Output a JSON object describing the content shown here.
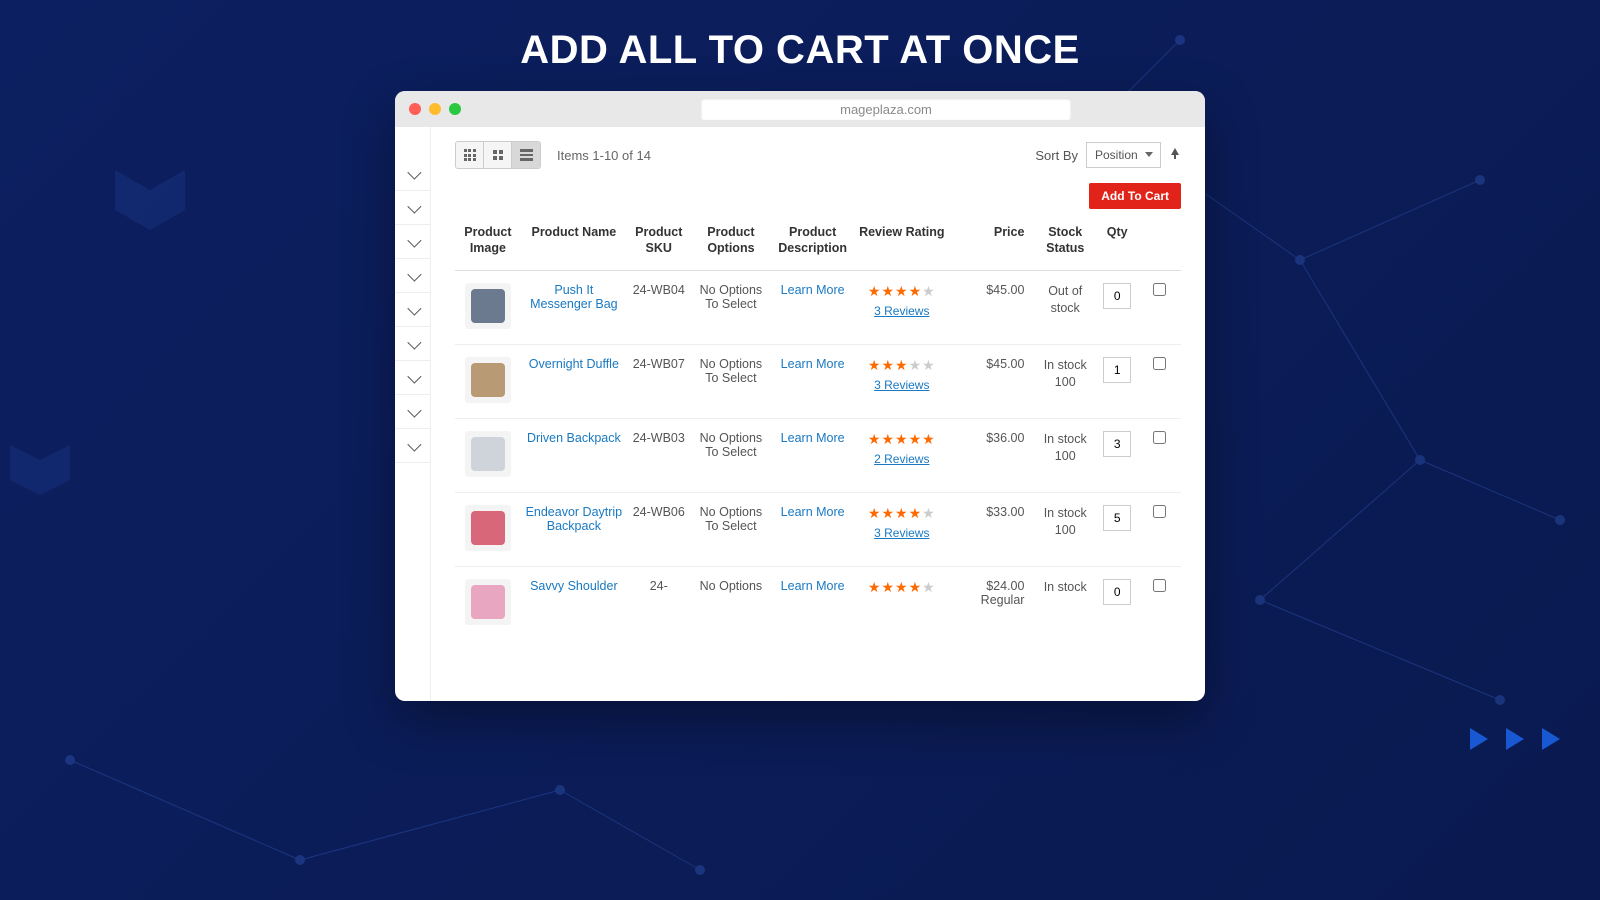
{
  "page": {
    "heading": "ADD ALL TO CART AT ONCE",
    "url": "mageplaza.com"
  },
  "toolbar": {
    "item_count": "Items 1-10 of 14",
    "sort_label": "Sort By",
    "sort_value": "Position",
    "add_to_cart_label": "Add To Cart"
  },
  "sidebar": {
    "filter_count": 9
  },
  "columns": {
    "image": "Product Image",
    "name": "Product Name",
    "sku": "Product SKU",
    "options": "Product Options",
    "description": "Product Description",
    "rating": "Review Rating",
    "price": "Price",
    "stock": "Stock Status",
    "qty": "Qty"
  },
  "common": {
    "learn_more": "Learn More",
    "no_options": "No Options To Select"
  },
  "rows": [
    {
      "name": "Push It Messenger Bag",
      "sku": "24-WB04",
      "rating_on": 3,
      "rating_half": true,
      "reviews": "3 Reviews",
      "price": "$45.00",
      "stock": "Out of stock",
      "qty": "0",
      "img_color": "#6b7a8f"
    },
    {
      "name": "Overnight Duffle",
      "sku": "24-WB07",
      "rating_on": 3,
      "rating_half": false,
      "reviews": "3 Reviews",
      "price": "$45.00",
      "stock": "In stock 100",
      "qty": "1",
      "img_color": "#b89a74"
    },
    {
      "name": "Driven Backpack",
      "sku": "24-WB03",
      "rating_on": 4,
      "rating_half": true,
      "reviews": "2 Reviews",
      "price": "$36.00",
      "stock": "In stock 100",
      "qty": "3",
      "img_color": "#cfd4da"
    },
    {
      "name": "Endeavor Daytrip Backpack",
      "sku": "24-WB06",
      "rating_on": 4,
      "rating_half": false,
      "reviews": "3 Reviews",
      "price": "$33.00",
      "stock": "In stock 100",
      "qty": "5",
      "img_color": "#d9677a"
    },
    {
      "name": "Savvy Shoulder",
      "sku": "24-",
      "rating_on": 4,
      "rating_half": false,
      "reviews": "",
      "price": "$24.00 Regular",
      "stock": "In stock",
      "qty": "0",
      "img_color": "#e9a6c0",
      "options_label": "No Options"
    }
  ]
}
